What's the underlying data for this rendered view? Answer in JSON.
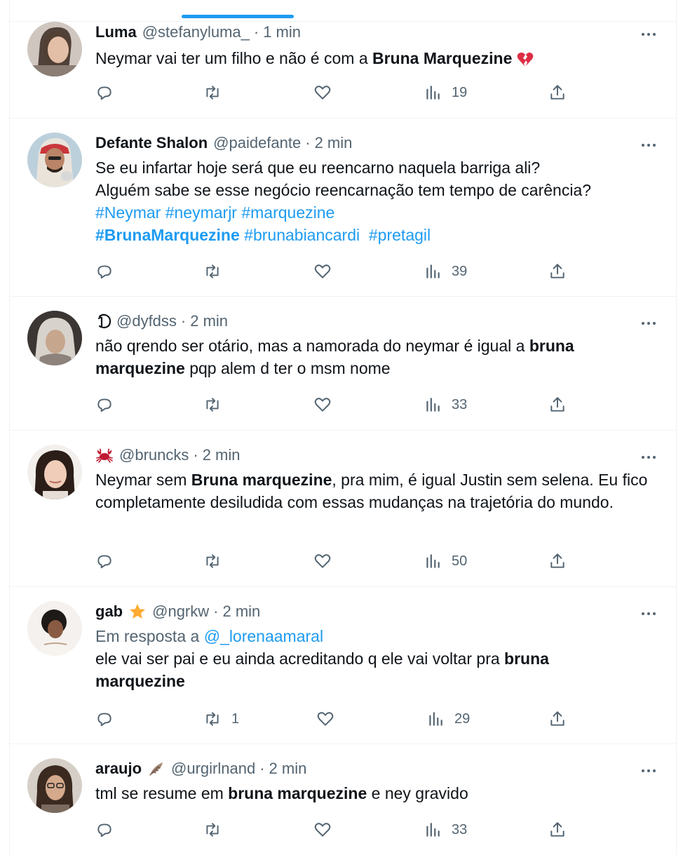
{
  "tweets": [
    {
      "name": "Luma",
      "handle": "@stefanyluma_",
      "sep": "·",
      "time": "1 min",
      "text": [
        {
          "t": "Neymar vai ter um filho e não é com a "
        },
        {
          "t": "Bruna Marquezine",
          "b": true
        }
      ],
      "emoji": "broken-heart-icon",
      "views": "19"
    },
    {
      "name": "Defante Shalon",
      "handle": "@paidefante",
      "sep": "·",
      "time": "2 min",
      "lines": [
        "Se eu infartar hoje será que eu reencarno naquela barriga ali?",
        "Alguém sabe se esse negócio reencarnação tem tempo de carência?"
      ],
      "hashtags_line1": [
        "#Neymar",
        "#neymarjr",
        "#marquezine"
      ],
      "hashtags_line2": [
        "#BrunaMarquezine",
        "#brunabiancardi",
        "#pretagil"
      ],
      "views": "39"
    },
    {
      "name_symbol": "fraktur-d-icon",
      "handle": "@dyfdss",
      "sep": "·",
      "time": "2 min",
      "text": [
        {
          "t": "não qrendo ser otário, mas a namorada do neymar é igual a "
        },
        {
          "t": "bruna marquezine",
          "b": true
        },
        {
          "t": " pqp alem d ter o msm nome"
        }
      ],
      "views": "33"
    },
    {
      "name_symbol": "crab-icon",
      "handle": "@bruncks",
      "sep": "·",
      "time": "2 min",
      "text": [
        {
          "t": "Neymar sem "
        },
        {
          "t": "Bruna marquezine",
          "b": true
        },
        {
          "t": ", pra mim, é igual Justin sem selena. Eu fico completamente desiludida com essas mudanças na trajetória do mundo."
        }
      ],
      "views": "50"
    },
    {
      "name": "gab",
      "name_emoji": "star-icon",
      "handle": "@ngrkw",
      "sep": "·",
      "time": "2 min",
      "reply_label": "Em resposta a",
      "reply_mention": "@_lorenaamaral",
      "text": [
        {
          "t": "ele vai ser pai e eu ainda acreditando q ele vai voltar pra "
        },
        {
          "t": "bruna marquezine",
          "b": true
        }
      ],
      "retweets": "1",
      "views": "29"
    },
    {
      "name": "araujo",
      "name_emoji": "feather-icon",
      "handle": "@urgirlnand",
      "sep": "·",
      "time": "2 min",
      "text": [
        {
          "t": "tml se resume em "
        },
        {
          "t": "bruna marquezine",
          "b": true
        },
        {
          "t": " e ney gravido"
        }
      ],
      "views": "33"
    }
  ],
  "colors": {
    "accent": "#1d9bf0",
    "secondary_text": "#536471",
    "primary_text": "#0f1419",
    "border": "#eff3f4"
  }
}
